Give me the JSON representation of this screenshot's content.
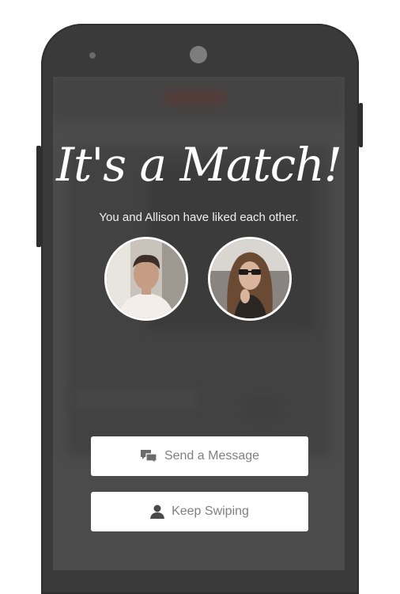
{
  "match_screen": {
    "title": "It's a Match!",
    "subtitle": "You and Allison have liked each other."
  },
  "buttons": {
    "send_message_label": "Send a Message",
    "keep_swiping_label": "Keep Swiping"
  },
  "icons": {
    "message": "chat-bubbles-icon",
    "swipe": "person-icon"
  },
  "colors": {
    "phone_body": "#3a3a3a",
    "overlay": "#4b4b4b",
    "button_bg": "#ffffff",
    "button_text": "#808080"
  }
}
